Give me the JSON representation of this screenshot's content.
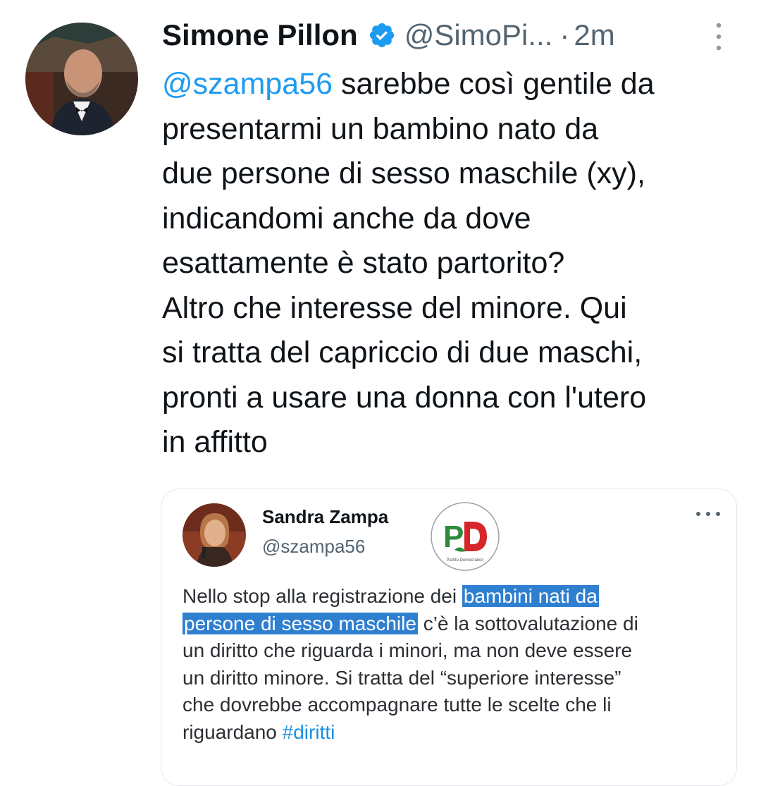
{
  "tweet": {
    "author_name": "Simone Pillon",
    "handle": "@SimoPi...",
    "separator": "·",
    "time": "2m",
    "mention": "@szampa56",
    "text_lines": [
      " sarebbe così gentile da",
      "presentarmi un bambino nato da",
      "due persone di sesso maschile (xy),",
      "indicandomi anche da dove",
      "esattamente è stato partorito?",
      "Altro che interesse del minore. Qui",
      "si tratta del capriccio di due maschi,",
      "pronti a usare una donna con l'utero",
      "in affitto"
    ]
  },
  "quoted": {
    "author_name": "Sandra Zampa",
    "handle": "@szampa56",
    "logo_text": "PD",
    "logo_caption": "Partito Democratico",
    "text_before": "Nello stop alla registrazione dei ",
    "highlight_1": "bambini nati da",
    "highlight_2": "persone di sesso maschile",
    "text_mid": " c’è la sottovalutazione di",
    "text_lines": [
      "un diritto che riguarda i minori, ma non deve essere",
      "un diritto minore. Si tratta del “superiore interesse”",
      "che dovrebbe accompagnare tutte le scelte che li",
      "riguardano "
    ],
    "hashtag": "#diritti"
  },
  "colors": {
    "link_blue": "#1d9bf0",
    "verified_blue": "#1d9bf0",
    "highlight_bg": "#2f7fd0",
    "secondary_text": "#536471"
  }
}
